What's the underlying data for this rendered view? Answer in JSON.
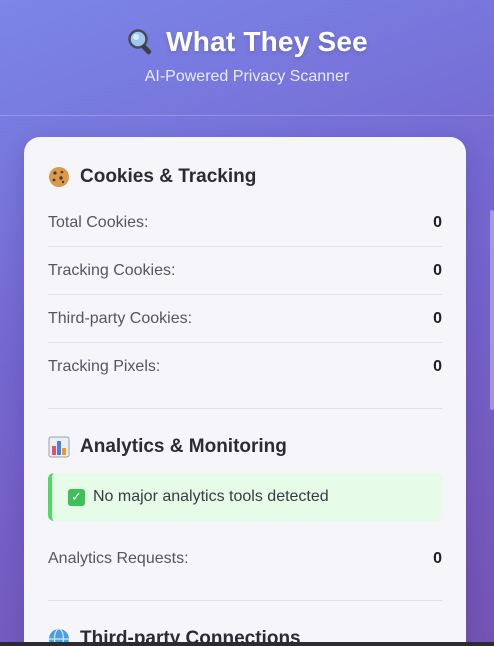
{
  "header": {
    "title": "What They See",
    "subtitle": "AI-Powered Privacy Scanner",
    "title_icon": "magnifier-icon"
  },
  "cookies": {
    "title": "Cookies & Tracking",
    "icon": "cookie-icon",
    "rows": [
      {
        "label": "Total Cookies:",
        "value": "0"
      },
      {
        "label": "Tracking Cookies:",
        "value": "0"
      },
      {
        "label": "Third-party Cookies:",
        "value": "0"
      },
      {
        "label": "Tracking Pixels:",
        "value": "0"
      }
    ]
  },
  "analytics": {
    "title": "Analytics & Monitoring",
    "icon": "bar-chart-icon",
    "notice": "No major analytics tools detected",
    "notice_icon": "check-icon",
    "rows": [
      {
        "label": "Analytics Requests:",
        "value": "0"
      }
    ]
  },
  "third_party": {
    "title": "Third-party Connections",
    "icon": "globe-icon"
  },
  "colors": {
    "accent_green": "#4cd964",
    "notice_bg": "#e6fbe8",
    "gradient_start": "#7b86e8",
    "gradient_end": "#7453b4"
  }
}
